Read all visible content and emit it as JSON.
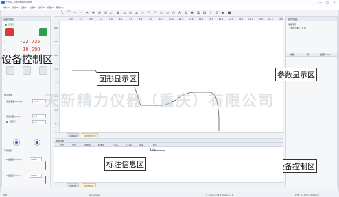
{
  "titlebar": {
    "title": "FPGA - 设备控制器测试软件",
    "min": "—",
    "max": "□",
    "close": "✕"
  },
  "menu": [
    "文件(F)",
    "编辑(E)",
    "设置(S)",
    "功能(F)",
    "运行(R)",
    "视图(V)",
    "帮助(H)"
  ],
  "toolbar_icons": [
    "line-icon",
    "arc-icon",
    "curve-icon",
    "point-icon",
    "cross-icon",
    "move-icon",
    "zoom-in-icon",
    "zoom-out-icon",
    "fit-icon",
    "grid-icon",
    "measure-icon",
    "target-icon",
    "angle-icon",
    "snap-icon",
    "undo-icon",
    "redo-icon",
    "circle-icon",
    "ellipse-icon",
    "polygon-icon",
    "text-icon",
    "settings-icon",
    "delete-icon",
    "copy-icon",
    "paste-icon",
    "export-icon",
    "import-icon",
    "run-icon",
    "stop-icon"
  ],
  "left_panel": {
    "title": "设备管理区",
    "status_label": "已连接",
    "axis_z_label": "Z:",
    "axis_z_value": "-22.735",
    "axis_x_label": "X:",
    "axis_x_value": "-10.000",
    "overlay": "设备控制区",
    "section_label": "单点测量",
    "speed_label": "测量速度(mm/s):",
    "speed_value": "25.0",
    "step_label": "测量步距(mm):",
    "step_value": "0.4",
    "custom_label": "自定义",
    "custom_value": "0.5",
    "manual_label": "手动控制",
    "z_speed_label": "Z轴速度(mm/s):",
    "z_speed_value": "10.00",
    "x_speed_label": "X轴速度(mm/s):",
    "x_speed_value": "10.00"
  },
  "graph": {
    "overlay": "图形显示区",
    "ruler_top": [
      "1.0",
      "2.0",
      "3.0",
      "4.0",
      "5.0",
      "6.0",
      "7.0",
      "8.0",
      "9.0",
      "10.0",
      "11.0",
      "12.0",
      "13.0",
      "14.0",
      "15.0",
      "16.0",
      "17.0",
      "18.0",
      "19.0",
      "20.0",
      "21.0",
      "22.0"
    ],
    "ruler_left": [
      "2.0",
      "1.0",
      "0.0",
      "-1.0",
      "-2.0",
      "-3.0",
      "-4.0",
      "-5.0"
    ],
    "tabs": [
      "轮廓编辑",
      "标注信息显示"
    ]
  },
  "watermark": "天新精力仪器（重庆）有限公司",
  "right_panel": {
    "title": "操作管理区",
    "tree_root": "测量项目",
    "tree_item": "测量元素1 - 1 线",
    "overlay": "参数显示区",
    "columns": [
      "参数",
      "值",
      "结果(mm)"
    ],
    "overlay2": "设备控制区"
  },
  "bottom": {
    "title": "测量结果",
    "overlay": "标注信息区",
    "columns": [
      "序号",
      "类型",
      "测量值",
      "标准值",
      "上公差",
      "下公差",
      "误差",
      "结论"
    ],
    "tooltip": "关注",
    "tabs": [
      "轮廓标注",
      "标注信息表"
    ]
  },
  "status": {
    "left": "就绪",
    "mid": "Undefined",
    "coords": "X_Scale:0.11  Z_Scale:0.11",
    "right": "状态: 0.14mm, 0.01mm"
  },
  "colors": {
    "accent": "#2d6fd6",
    "red_value": "#c0392b",
    "green": "#2f9c4f"
  }
}
